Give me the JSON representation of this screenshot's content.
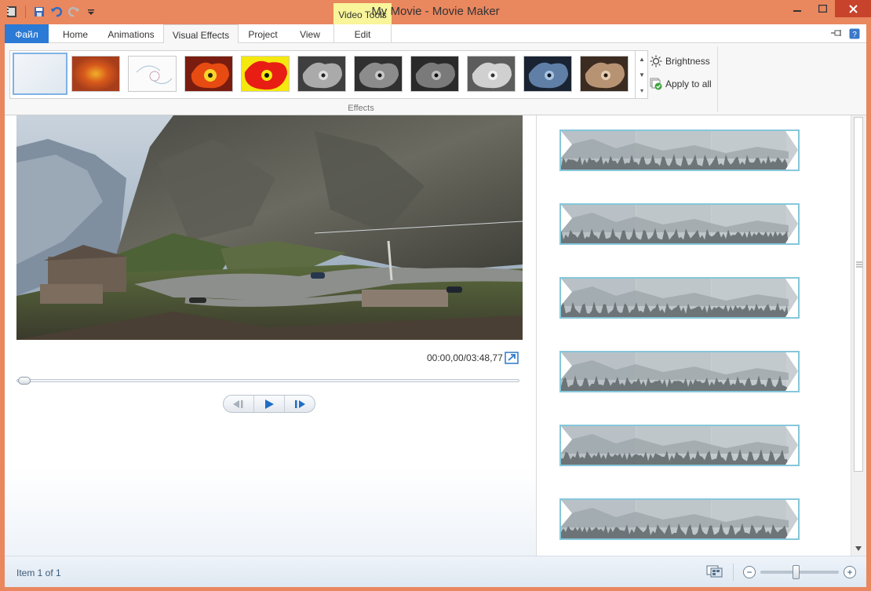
{
  "window": {
    "title": "My Movie - Movie Maker",
    "context_tab_group": "Video Tools"
  },
  "ribbon": {
    "tabs": [
      {
        "id": "file",
        "label": "Файл"
      },
      {
        "id": "home",
        "label": "Home"
      },
      {
        "id": "animations",
        "label": "Animations"
      },
      {
        "id": "visual-effects",
        "label": "Visual Effects"
      },
      {
        "id": "project",
        "label": "Project"
      },
      {
        "id": "view",
        "label": "View"
      },
      {
        "id": "edit",
        "label": "Edit"
      }
    ],
    "active_tab": "visual-effects",
    "effects_group_label": "Effects",
    "brightness_label": "Brightness",
    "apply_to_all_label": "Apply to all",
    "effects": [
      {
        "name": "no-effect",
        "selected": true
      },
      {
        "name": "blur-warm"
      },
      {
        "name": "edge-detect"
      },
      {
        "name": "warm-saturated"
      },
      {
        "name": "posterize"
      },
      {
        "name": "grayscale-1"
      },
      {
        "name": "grayscale-2"
      },
      {
        "name": "grayscale-3"
      },
      {
        "name": "grayscale-light"
      },
      {
        "name": "cyan-tone"
      },
      {
        "name": "sepia"
      }
    ]
  },
  "preview": {
    "time": "00:00,00/03:48,77",
    "seek_progress": 0.0
  },
  "storyboard": {
    "clip_count": 6
  },
  "status": {
    "text": "Item 1 of 1",
    "zoom_level": 0.45
  },
  "colors": {
    "frame": "#e9875f",
    "accent": "#2b7ad6",
    "clip_border": "#86c7da",
    "context_tab": "#f8f59a"
  }
}
